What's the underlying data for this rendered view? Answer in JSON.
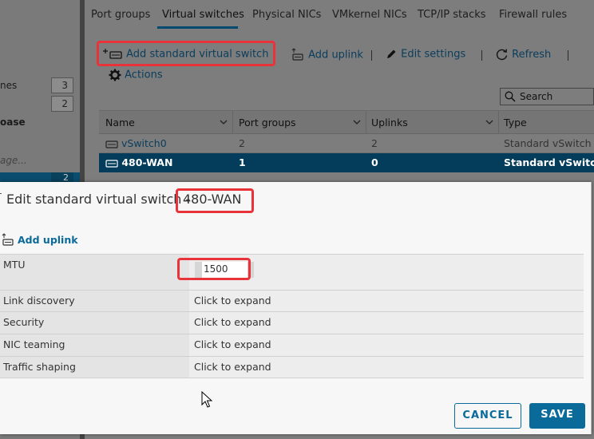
{
  "sidebar": {
    "rows": [
      {
        "label": "nes",
        "value": "3"
      },
      {
        "label": "",
        "value": "2"
      },
      {
        "label": "oase",
        "value": ""
      },
      {
        "label": "age...",
        "value": ""
      }
    ],
    "selected_value": "2"
  },
  "tabs": [
    {
      "label": "Port groups"
    },
    {
      "label": "Virtual switches"
    },
    {
      "label": "Physical NICs"
    },
    {
      "label": "VMkernel NICs"
    },
    {
      "label": "TCP/IP stacks"
    },
    {
      "label": "Firewall rules"
    }
  ],
  "toolbar": {
    "add_switch": "Add standard virtual switch",
    "add_uplink": "Add uplink",
    "edit_settings": "Edit settings",
    "refresh": "Refresh",
    "actions": "Actions"
  },
  "search": {
    "placeholder": "Search"
  },
  "grid": {
    "columns": [
      "Name",
      "Port groups",
      "Uplinks",
      "Type"
    ],
    "rows": [
      {
        "name": "vSwitch0",
        "port_groups": "2",
        "uplinks": "2",
        "type": "Standard vSwitch"
      },
      {
        "name": "480-WAN",
        "port_groups": "1",
        "uplinks": "0",
        "type": "Standard vSwitch"
      }
    ]
  },
  "dialog": {
    "title": "Edit standard virtual switch -",
    "name": "480-WAN",
    "add_uplink": "Add uplink",
    "properties": [
      {
        "label": "MTU",
        "value": "1500"
      },
      {
        "label": "Link discovery",
        "value": "Click to expand"
      },
      {
        "label": "Security",
        "value": "Click to expand"
      },
      {
        "label": "NIC teaming",
        "value": "Click to expand"
      },
      {
        "label": "Traffic shaping",
        "value": "Click to expand"
      }
    ],
    "cancel": "CANCEL",
    "save": "SAVE"
  },
  "colors": {
    "accent": "#0a6a99",
    "selected_row": "#033d5b",
    "highlight": "#e8333a"
  }
}
